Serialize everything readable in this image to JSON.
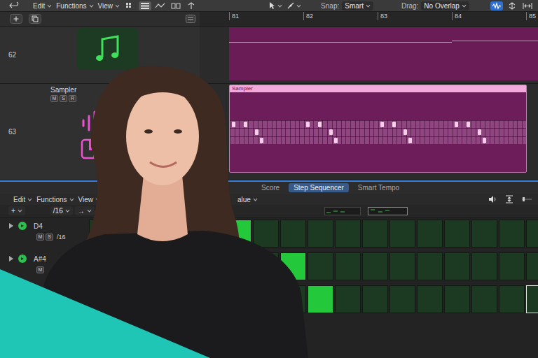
{
  "toolbar": {
    "menus": [
      "Edit",
      "Functions",
      "View"
    ],
    "view_buttons": [
      {
        "selected": false
      },
      {
        "selected": true
      },
      {
        "selected": false
      },
      {
        "selected": false
      },
      {
        "selected": false
      }
    ],
    "snap": {
      "label": "Snap:",
      "value": "Smart"
    },
    "drag": {
      "label": "Drag:",
      "value": "No Overlap"
    },
    "right_buttons": [
      {
        "selected": true
      },
      {
        "selected": false
      },
      {
        "selected": false
      }
    ]
  },
  "ruler": [
    "81",
    "82",
    "83",
    "84",
    "85"
  ],
  "tracks": [
    {
      "number": "62",
      "kind": "instrument"
    },
    {
      "number": "63",
      "kind": "sampler",
      "name": "Sampler",
      "buttons": [
        "M",
        "S",
        "R"
      ],
      "region_label": "Sampler",
      "notes": [
        {
          "pos": 1,
          "row": 0
        },
        {
          "pos": 6,
          "row": 0
        },
        {
          "pos": 11,
          "row": 1
        },
        {
          "pos": 13,
          "row": 2
        },
        {
          "pos": 33,
          "row": 0
        },
        {
          "pos": 38,
          "row": 0
        },
        {
          "pos": 43,
          "row": 1
        },
        {
          "pos": 45,
          "row": 2
        },
        {
          "pos": 65,
          "row": 0
        },
        {
          "pos": 70,
          "row": 0
        },
        {
          "pos": 75,
          "row": 1
        },
        {
          "pos": 77,
          "row": 2
        },
        {
          "pos": 97,
          "row": 0
        },
        {
          "pos": 102,
          "row": 0
        },
        {
          "pos": 107,
          "row": 1
        },
        {
          "pos": 109,
          "row": 2
        }
      ]
    }
  ],
  "editor": {
    "tabs": [
      {
        "label": "Score",
        "selected": false
      },
      {
        "label": "Step Sequencer",
        "selected": true
      },
      {
        "label": "Smart Tempo",
        "selected": false
      }
    ],
    "menus": [
      "Edit",
      "Functions",
      "View"
    ],
    "value_menu": "alue",
    "add_button": "+",
    "step_rate": "/16",
    "arrow_menu": "→",
    "rows": [
      {
        "name": "D4",
        "expanded": false,
        "on": true,
        "buttons": [
          "M",
          "S"
        ],
        "rate": "/16",
        "steps": [
          {
            "on": false,
            "selected": false
          },
          {
            "on": false,
            "selected": false
          },
          {
            "on": false,
            "selected": false
          },
          {
            "on": false,
            "selected": false
          },
          {
            "on": false,
            "selected": false
          },
          {
            "on": true,
            "selected": false
          },
          {
            "on": false,
            "selected": false
          },
          {
            "on": false,
            "selected": false
          },
          {
            "on": false,
            "selected": false
          },
          {
            "on": false,
            "selected": false
          },
          {
            "on": false,
            "selected": false
          },
          {
            "on": false,
            "selected": false
          },
          {
            "on": false,
            "selected": false
          },
          {
            "on": false,
            "selected": false
          },
          {
            "on": false,
            "selected": false
          },
          {
            "on": false,
            "selected": false
          },
          {
            "on": false,
            "selected": false
          }
        ]
      },
      {
        "name": "A#4",
        "expanded": false,
        "on": true,
        "buttons": [
          "M"
        ],
        "steps": [
          {
            "on": false,
            "selected": false
          },
          {
            "on": false,
            "selected": false
          },
          {
            "on": false,
            "selected": false
          },
          {
            "on": false,
            "selected": false
          },
          {
            "on": false,
            "selected": false
          },
          {
            "on": false,
            "selected": false
          },
          {
            "on": false,
            "selected": false
          },
          {
            "on": true,
            "selected": false
          },
          {
            "on": false,
            "selected": false
          },
          {
            "on": false,
            "selected": false
          },
          {
            "on": false,
            "selected": false
          },
          {
            "on": false,
            "selected": false
          },
          {
            "on": false,
            "selected": false
          },
          {
            "on": false,
            "selected": false
          },
          {
            "on": false,
            "selected": false
          },
          {
            "on": false,
            "selected": false
          },
          {
            "on": false,
            "selected": false
          }
        ]
      },
      {
        "steps": [
          {
            "on": false,
            "selected": false
          },
          {
            "on": false,
            "selected": false
          },
          {
            "on": false,
            "selected": false
          },
          {
            "on": false,
            "selected": false
          },
          {
            "on": false,
            "selected": false
          },
          {
            "on": false,
            "selected": false
          },
          {
            "on": false,
            "selected": false
          },
          {
            "on": false,
            "selected": false
          },
          {
            "on": true,
            "selected": false
          },
          {
            "on": false,
            "selected": false
          },
          {
            "on": false,
            "selected": false
          },
          {
            "on": false,
            "selected": false
          },
          {
            "on": false,
            "selected": false
          },
          {
            "on": false,
            "selected": false
          },
          {
            "on": false,
            "selected": false
          },
          {
            "on": false,
            "selected": false
          },
          {
            "on": false,
            "selected": true
          }
        ]
      }
    ]
  }
}
